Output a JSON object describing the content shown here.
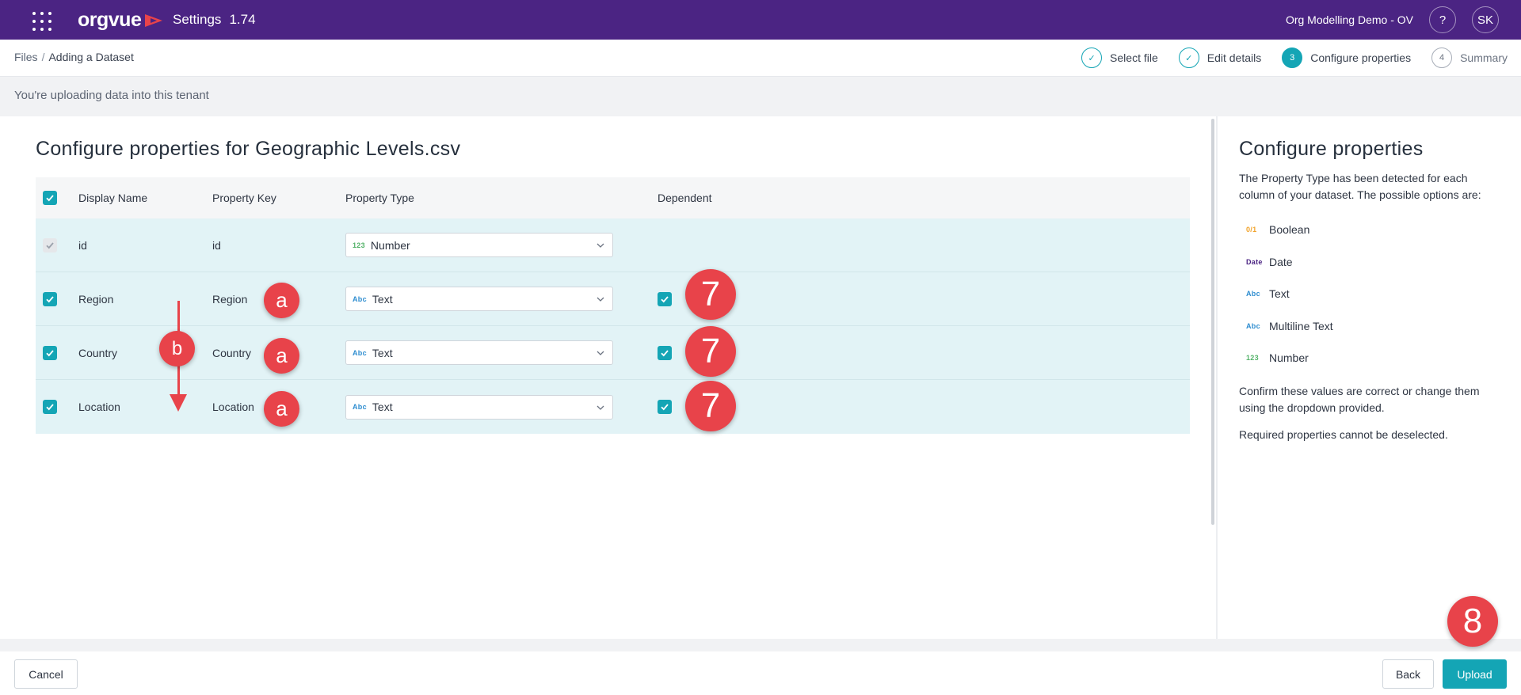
{
  "topbar": {
    "logo_text": "orgvue",
    "app_name": "Settings",
    "app_version": "1.74",
    "tenant": "Org Modelling Demo - OV",
    "help_label": "?",
    "avatar_initials": "SK"
  },
  "breadcrumb": {
    "files": "Files",
    "separator": "/",
    "current": "Adding a Dataset"
  },
  "steps": [
    {
      "label": "Select file",
      "state": "done",
      "marker": "✓"
    },
    {
      "label": "Edit details",
      "state": "done",
      "marker": "✓"
    },
    {
      "label": "Configure properties",
      "state": "active",
      "marker": "3"
    },
    {
      "label": "Summary",
      "state": "pending",
      "marker": "4"
    }
  ],
  "banner": {
    "text": "You're uploading data into this tenant"
  },
  "main": {
    "heading": "Configure properties for Geographic Levels.csv",
    "columns": {
      "display_name": "Display Name",
      "property_key": "Property Key",
      "property_type": "Property Type",
      "dependent": "Dependent"
    },
    "rows": [
      {
        "display_name": "id",
        "key": "id",
        "type_badge": "123",
        "type": "Number",
        "checked": true,
        "required": true
      },
      {
        "display_name": "Region",
        "key": "Region",
        "type_badge": "Abc",
        "type": "Text",
        "checked": true,
        "dependent": true
      },
      {
        "display_name": "Country",
        "key": "Country",
        "type_badge": "Abc",
        "type": "Text",
        "checked": true,
        "dependent": true
      },
      {
        "display_name": "Location",
        "key": "Location",
        "type_badge": "Abc",
        "type": "Text",
        "checked": true,
        "dependent": true
      }
    ]
  },
  "annotations": {
    "a": "a",
    "b": "b",
    "seven": "7",
    "eight": "8"
  },
  "side": {
    "title": "Configure properties",
    "description": "The Property Type has been detected for each column of your dataset. The possible options are:",
    "options": [
      {
        "badge": "0/1",
        "label": "Boolean"
      },
      {
        "badge": "Date",
        "label": "Date"
      },
      {
        "badge": "Abc",
        "label": "Text"
      },
      {
        "badge": "Abc",
        "label": "Multiline Text"
      },
      {
        "badge": "123",
        "label": "Number"
      }
    ],
    "confirm_note": "Confirm these values are correct or change them using the dropdown provided.",
    "required_note": "Required properties cannot be deselected."
  },
  "footer": {
    "cancel": "Cancel",
    "back": "Back",
    "upload": "Upload"
  },
  "colors": {
    "topbar": "#4b2483",
    "accent": "#14a5b5",
    "row_bg": "#e2f3f6",
    "annotation": "#e8434a"
  }
}
